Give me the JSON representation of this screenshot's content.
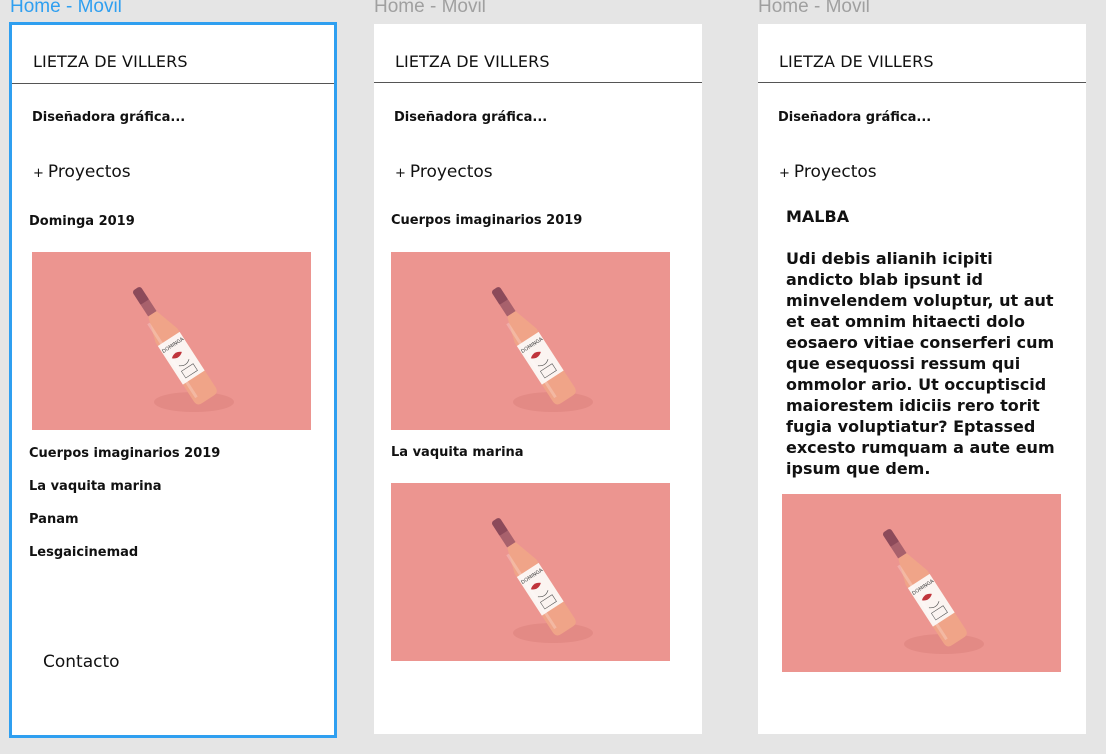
{
  "artboards": [
    {
      "label": "Home - Movil"
    },
    {
      "label": "Home - Movil"
    },
    {
      "label": "Home - Movil"
    }
  ],
  "site": {
    "title": "LIETZA DE VILLERS",
    "subtitle": "Diseñadora gráfica...",
    "projects_link": "Proyectos",
    "projects_plus": "+"
  },
  "screen1": {
    "featured_title": "Dominga 2019",
    "projects": [
      "Cuerpos imaginarios 2019",
      "La vaquita marina",
      "Panam",
      "Lesgaicinemad"
    ],
    "contact": "Contacto"
  },
  "screen2": {
    "project_a": "Cuerpos imaginarios 2019",
    "project_b": "La vaquita marina"
  },
  "screen3": {
    "title": "MALBA",
    "body": "Udi debis alianih icipiti andicto blab ipsunt id minvelendem voluptur, ut aut et eat omnim hitaecti dolo eosaero vitiae conserferi cum que esequossi ressum qui ommolor ario. Ut occuptiscid maiorestem idiciis rero torit fugia voluptiatur? Eptassed excesto rumquam a aute eum ipsum que dem."
  },
  "photo": {
    "label_text": "DOMINGA",
    "background": "#ec9590",
    "glass_color": "#f0a488",
    "cap_color": "#8c4a5a"
  }
}
